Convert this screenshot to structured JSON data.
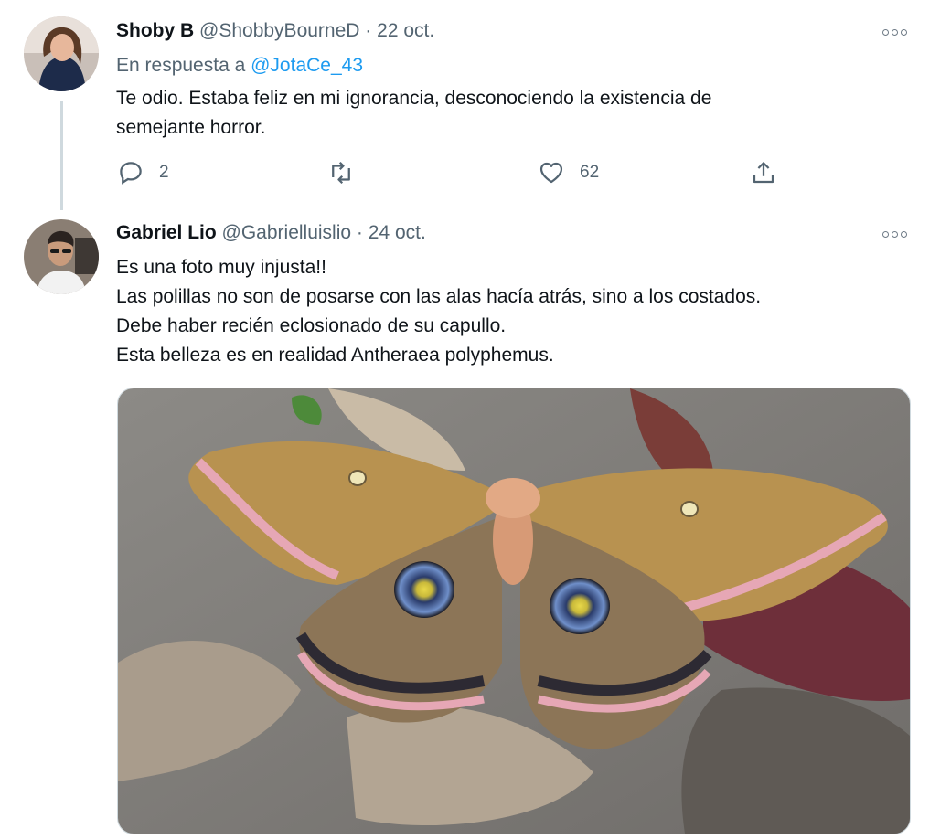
{
  "tweets": [
    {
      "name": "Shoby B",
      "handle": "@ShobbyBourneD",
      "separator": "·",
      "date": "22 oct.",
      "reply_prefix": "En respuesta a",
      "reply_handle": "@JotaCe_43",
      "text": "Te odio. Estaba feliz en mi ignorancia, desconociendo la existencia de\nsemejante horror.",
      "actions": {
        "reply_count": "2",
        "retweet_count": "",
        "like_count": "62"
      },
      "icons": [
        "reply-icon",
        "retweet-icon",
        "heart-icon",
        "share-icon",
        "more-icon"
      ]
    },
    {
      "name": "Gabriel Lio",
      "handle": "@Gabrielluislio",
      "separator": "·",
      "date": "24 oct.",
      "text": "Es una foto muy injusta!!\nLas polillas no son de posarse con las alas hacía atrás, sino a los costados.\nDebe haber recién eclosionado de su capullo.\nEsta belleza es en realidad Antheraea polyphemus.",
      "icons": [
        "more-icon"
      ]
    }
  ],
  "colors": {
    "accent": "#1d9bf0",
    "secondary_text": "#536471",
    "thread_line": "#cfd9de"
  }
}
